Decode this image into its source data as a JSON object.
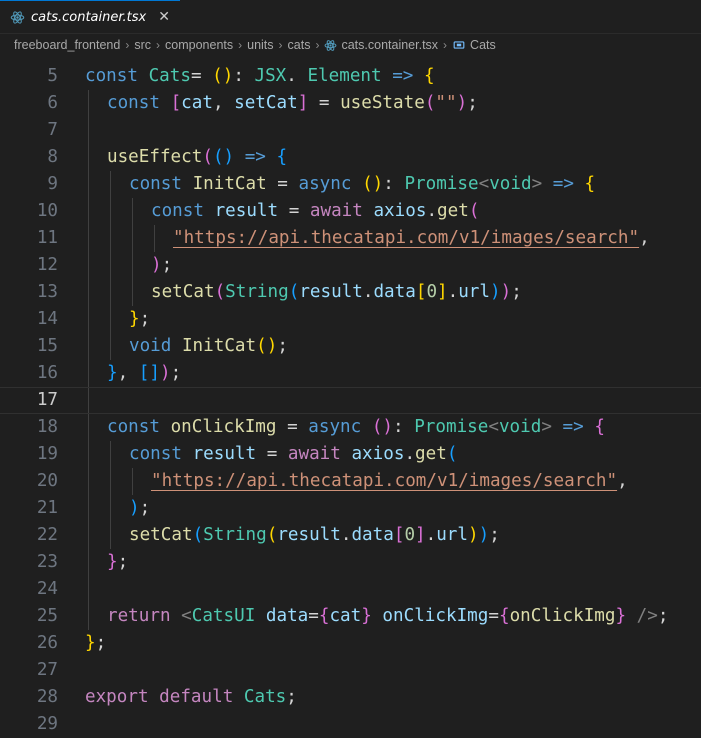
{
  "tab": {
    "filename": "cats.container.tsx",
    "close_glyph": "✕"
  },
  "breadcrumb": {
    "items": [
      "freeboard_frontend",
      "src",
      "components",
      "units",
      "cats",
      "cats.container.tsx",
      "Cats"
    ],
    "separator": "›"
  },
  "editor": {
    "current_line": 17,
    "lines": [
      {
        "n": "5",
        "indent": 0,
        "tokens": [
          [
            "kwb",
            "const "
          ],
          [
            "ty",
            "Cats"
          ],
          [
            "",
            "= "
          ],
          [
            "br1",
            "()"
          ],
          [
            "",
            ": "
          ],
          [
            "ty",
            "JSX"
          ],
          [
            "",
            ". "
          ],
          [
            "ty",
            "Element"
          ],
          [
            "kwb",
            " => "
          ],
          [
            "br1",
            "{"
          ]
        ]
      },
      {
        "n": "6",
        "indent": 1,
        "tokens": [
          [
            "kwb",
            "const "
          ],
          [
            "br2",
            "["
          ],
          [
            "vr",
            "cat"
          ],
          [
            "",
            ", "
          ],
          [
            "vr",
            "setCat"
          ],
          [
            "br2",
            "]"
          ],
          [
            "",
            " = "
          ],
          [
            "fn",
            "useState"
          ],
          [
            "br2",
            "("
          ],
          [
            "str",
            "\"\""
          ],
          [
            "br2",
            ")"
          ],
          [
            "",
            ";"
          ]
        ]
      },
      {
        "n": "7",
        "indent": 1,
        "tokens": []
      },
      {
        "n": "8",
        "indent": 1,
        "tokens": [
          [
            "fn",
            "useEffect"
          ],
          [
            "br2",
            "("
          ],
          [
            "br3",
            "()"
          ],
          [
            "kwb",
            " => "
          ],
          [
            "br3",
            "{"
          ]
        ]
      },
      {
        "n": "9",
        "indent": 2,
        "tokens": [
          [
            "kwb",
            "const "
          ],
          [
            "fn",
            "InitCat"
          ],
          [
            "",
            " = "
          ],
          [
            "kwb",
            "async "
          ],
          [
            "br1",
            "()"
          ],
          [
            "",
            ": "
          ],
          [
            "ty",
            "Promise"
          ],
          [
            "tag",
            "<"
          ],
          [
            "ty",
            "void"
          ],
          [
            "tag",
            ">"
          ],
          [
            "kwb",
            " => "
          ],
          [
            "br1",
            "{"
          ]
        ]
      },
      {
        "n": "10",
        "indent": 3,
        "tokens": [
          [
            "kwb",
            "const "
          ],
          [
            "vr",
            "result"
          ],
          [
            "",
            " = "
          ],
          [
            "kw",
            "await "
          ],
          [
            "vr",
            "axios"
          ],
          [
            "",
            "."
          ],
          [
            "fn",
            "get"
          ],
          [
            "br2",
            "("
          ]
        ]
      },
      {
        "n": "11",
        "indent": 4,
        "tokens": [
          [
            "str wavy",
            "\"https://api.thecatapi.com/v1/images/search\""
          ],
          [
            "",
            ","
          ]
        ]
      },
      {
        "n": "12",
        "indent": 3,
        "tokens": [
          [
            "br2",
            ")"
          ],
          [
            "",
            ";"
          ]
        ]
      },
      {
        "n": "13",
        "indent": 3,
        "tokens": [
          [
            "fn",
            "setCat"
          ],
          [
            "br2",
            "("
          ],
          [
            "ty",
            "String"
          ],
          [
            "br3",
            "("
          ],
          [
            "vr",
            "result"
          ],
          [
            "",
            "."
          ],
          [
            "vr",
            "data"
          ],
          [
            "br1",
            "["
          ],
          [
            "num",
            "0"
          ],
          [
            "br1",
            "]"
          ],
          [
            "",
            "."
          ],
          [
            "vr",
            "url"
          ],
          [
            "br3",
            ")"
          ],
          [
            "br2",
            ")"
          ],
          [
            "",
            ";"
          ]
        ]
      },
      {
        "n": "14",
        "indent": 2,
        "tokens": [
          [
            "br1",
            "}"
          ],
          [
            "",
            ";"
          ]
        ]
      },
      {
        "n": "15",
        "indent": 2,
        "tokens": [
          [
            "kwb",
            "void "
          ],
          [
            "fn",
            "InitCat"
          ],
          [
            "br1",
            "()"
          ],
          [
            "",
            ";"
          ]
        ]
      },
      {
        "n": "16",
        "indent": 1,
        "tokens": [
          [
            "br3",
            "}"
          ],
          [
            "",
            ", "
          ],
          [
            "br3",
            "[]"
          ],
          [
            "br2",
            ")"
          ],
          [
            "",
            ";"
          ]
        ]
      },
      {
        "n": "17",
        "indent": 1,
        "tokens": []
      },
      {
        "n": "18",
        "indent": 1,
        "tokens": [
          [
            "kwb",
            "const "
          ],
          [
            "fn",
            "onClickImg"
          ],
          [
            "",
            " = "
          ],
          [
            "kwb",
            "async "
          ],
          [
            "br2",
            "()"
          ],
          [
            "",
            ": "
          ],
          [
            "ty",
            "Promise"
          ],
          [
            "tag",
            "<"
          ],
          [
            "ty",
            "void"
          ],
          [
            "tag",
            ">"
          ],
          [
            "kwb",
            " => "
          ],
          [
            "br2",
            "{"
          ]
        ]
      },
      {
        "n": "19",
        "indent": 2,
        "tokens": [
          [
            "kwb",
            "const "
          ],
          [
            "vr",
            "result"
          ],
          [
            "",
            " = "
          ],
          [
            "kw",
            "await "
          ],
          [
            "vr",
            "axios"
          ],
          [
            "",
            "."
          ],
          [
            "fn",
            "get"
          ],
          [
            "br3",
            "("
          ]
        ]
      },
      {
        "n": "20",
        "indent": 3,
        "tokens": [
          [
            "str wavy",
            "\"https://api.thecatapi.com/v1/images/search\""
          ],
          [
            "",
            ","
          ]
        ]
      },
      {
        "n": "21",
        "indent": 2,
        "tokens": [
          [
            "br3",
            ")"
          ],
          [
            "",
            ";"
          ]
        ]
      },
      {
        "n": "22",
        "indent": 2,
        "tokens": [
          [
            "fn",
            "setCat"
          ],
          [
            "br3",
            "("
          ],
          [
            "ty",
            "String"
          ],
          [
            "br1",
            "("
          ],
          [
            "vr",
            "result"
          ],
          [
            "",
            "."
          ],
          [
            "vr",
            "data"
          ],
          [
            "br2",
            "["
          ],
          [
            "num",
            "0"
          ],
          [
            "br2",
            "]"
          ],
          [
            "",
            "."
          ],
          [
            "vr",
            "url"
          ],
          [
            "br1",
            ")"
          ],
          [
            "br3",
            ")"
          ],
          [
            "",
            ";"
          ]
        ]
      },
      {
        "n": "23",
        "indent": 1,
        "tokens": [
          [
            "br2",
            "}"
          ],
          [
            "",
            ";"
          ]
        ]
      },
      {
        "n": "24",
        "indent": 1,
        "tokens": []
      },
      {
        "n": "25",
        "indent": 1,
        "tokens": [
          [
            "kw",
            "return "
          ],
          [
            "tag",
            "<"
          ],
          [
            "jsx",
            "CatsUI"
          ],
          [
            "vr",
            " data"
          ],
          [
            "",
            "="
          ],
          [
            "br2",
            "{"
          ],
          [
            "vr",
            "cat"
          ],
          [
            "br2",
            "}"
          ],
          [
            "vr",
            " onClickImg"
          ],
          [
            "",
            "="
          ],
          [
            "br2",
            "{"
          ],
          [
            "fn",
            "onClickImg"
          ],
          [
            "br2",
            "}"
          ],
          [
            "tag",
            " />"
          ],
          [
            "",
            ";"
          ]
        ]
      },
      {
        "n": "26",
        "indent": 0,
        "tokens": [
          [
            "br1",
            "}"
          ],
          [
            "",
            ";"
          ]
        ]
      },
      {
        "n": "27",
        "indent": 0,
        "tokens": []
      },
      {
        "n": "28",
        "indent": 0,
        "tokens": [
          [
            "kw",
            "export "
          ],
          [
            "kw",
            "default "
          ],
          [
            "ty",
            "Cats"
          ],
          [
            "",
            ";"
          ]
        ]
      },
      {
        "n": "29",
        "indent": 0,
        "tokens": []
      }
    ]
  }
}
